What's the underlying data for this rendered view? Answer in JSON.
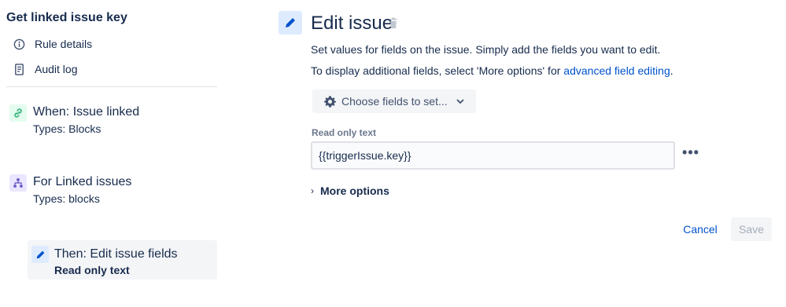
{
  "sidebar": {
    "rule_title": "Get linked issue key",
    "nav": [
      {
        "label": "Rule details",
        "icon": "info-icon"
      },
      {
        "label": "Audit log",
        "icon": "document-icon"
      }
    ],
    "steps": {
      "trigger": {
        "title": "When: Issue linked",
        "subtitle": "Types: Blocks",
        "icon": "link-icon",
        "icon_color": "#36B37E"
      },
      "branch": {
        "title": "For Linked issues",
        "subtitle": "Types: blocks",
        "icon": "hierarchy-icon",
        "icon_color": "#6554C0"
      },
      "action": {
        "title": "Then: Edit issue fields",
        "subtitle": "Read only text",
        "icon": "pencil-icon",
        "icon_color": "#0052CC"
      }
    }
  },
  "main": {
    "title": "Edit issue",
    "description": "Set values for fields on the issue. Simply add the fields you want to edit.",
    "extra_prefix": "To display additional fields, select 'More options' for ",
    "extra_link": "advanced field editing",
    "extra_suffix": ".",
    "choose_fields_label": "Choose fields to set...",
    "field": {
      "label": "Read only text",
      "value": "{{triggerIssue.key}}"
    },
    "more_options_label": "More options",
    "cancel_label": "Cancel",
    "save_label": "Save"
  },
  "colors": {
    "accent": "#0052CC",
    "text": "#172B4D",
    "muted": "#6B778C"
  }
}
